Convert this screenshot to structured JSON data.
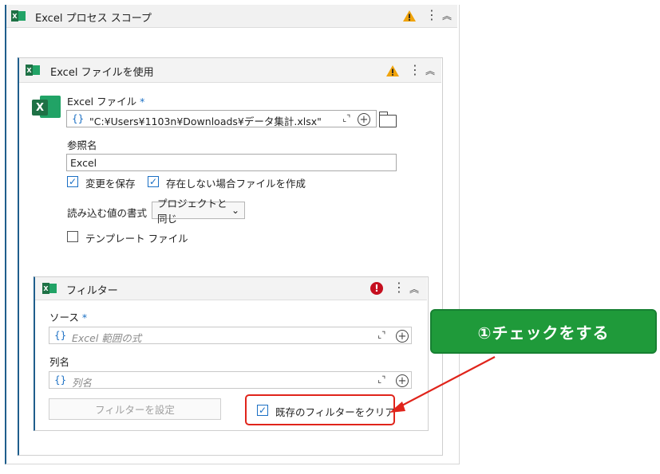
{
  "outer": {
    "title": "Excel プロセス スコープ",
    "kebab": "⋮",
    "collapse": "︽"
  },
  "card": {
    "title": "Excel ファイルを使用",
    "kebab": "⋮",
    "collapse": "︽",
    "excel_file_label": "Excel ファイル",
    "required_mark": "*",
    "brace": "{}",
    "file_path": "\"C:¥Users¥1103n¥Downloads¥データ集計.xlsx\"",
    "expand": "⌞⌝",
    "plus": "+",
    "ref_label": "参照名",
    "ref_value": "Excel",
    "save_changes_label": "変更を保存",
    "create_if_missing_label": "存在しない場合ファイルを作成",
    "value_format_label": "読み込む値の書式",
    "value_format_selected": "プロジェクトと同じ",
    "chevron": "⌄",
    "template_file_label": "テンプレート ファイル"
  },
  "filter": {
    "title": "フィルター",
    "error_mark": "!",
    "kebab": "⋮",
    "collapse": "︽",
    "source_label": "ソース",
    "required_mark": "*",
    "brace": "{}",
    "source_placeholder": "Excel 範囲の式",
    "column_label": "列名",
    "column_placeholder": "列名",
    "expand": "⌞⌝",
    "plus": "+",
    "set_filter_button": "フィルターを設定",
    "clear_existing_label": "既存のフィルターをクリア"
  },
  "annotation": {
    "callout_text": "①チェックをする",
    "highlight_color": "#e0241b",
    "callout_color": "#1f9a3a"
  },
  "icons": {
    "excel": "excel-icon",
    "warning": "warning-icon",
    "error": "error-icon",
    "folder": "folder-icon",
    "plus": "plus-circle-icon",
    "expand": "expand-icon"
  }
}
